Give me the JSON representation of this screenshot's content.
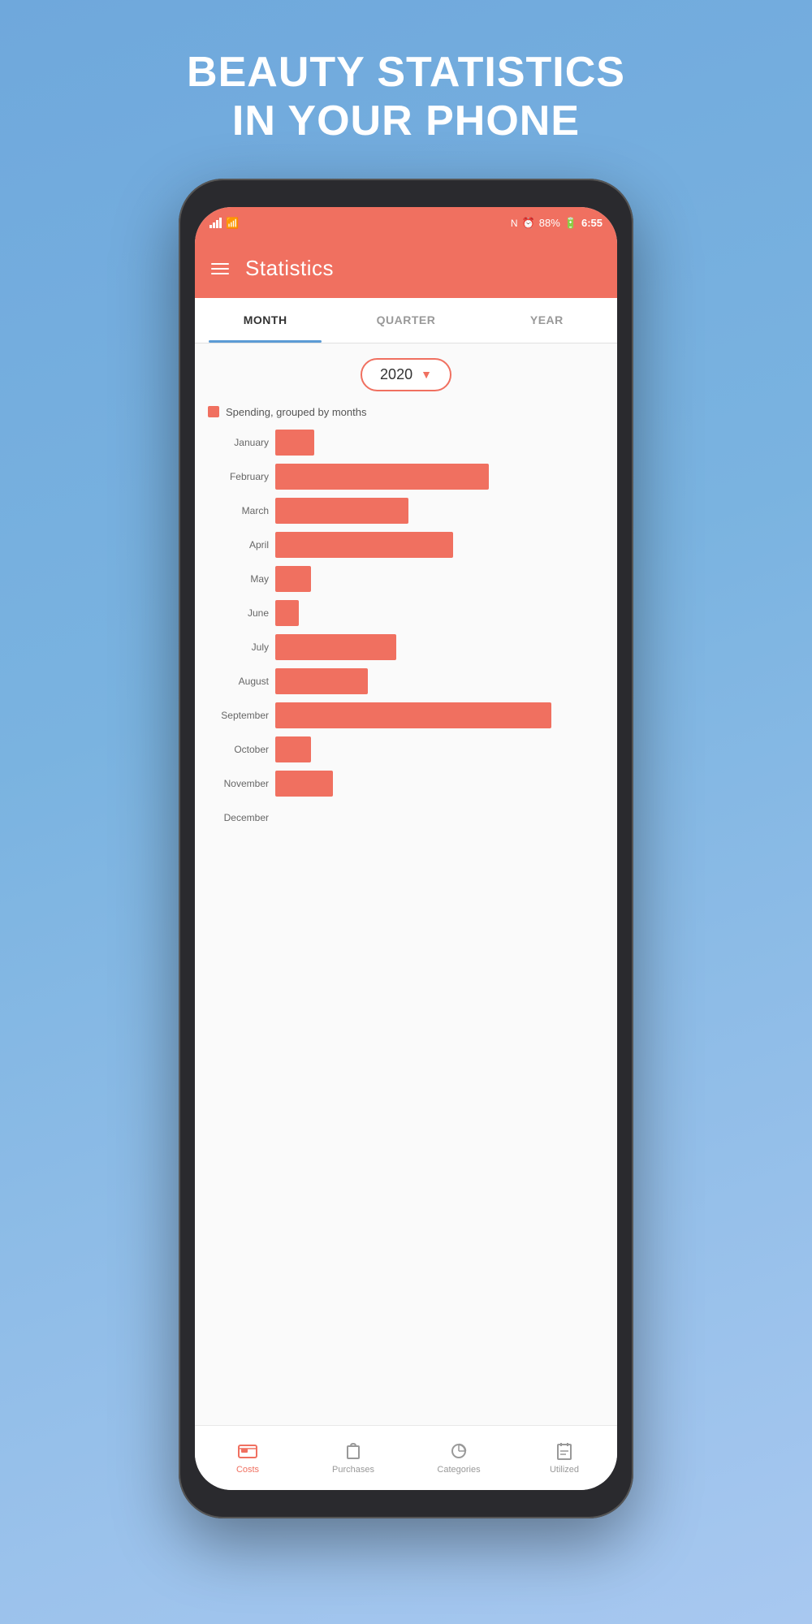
{
  "hero": {
    "line1": "BEAUTY STATISTICS",
    "line2": "IN YOUR PHONE"
  },
  "status_bar": {
    "battery": "88%",
    "time": "6:55"
  },
  "header": {
    "title": "Statistics"
  },
  "tabs": [
    {
      "label": "MONTH",
      "active": true
    },
    {
      "label": "QUARTER",
      "active": false
    },
    {
      "label": "YEAR",
      "active": false
    }
  ],
  "year_selector": {
    "value": "2020"
  },
  "chart": {
    "legend": "Spending, grouped by months",
    "max_value": 389,
    "bars": [
      {
        "month": "January",
        "value": 55
      },
      {
        "month": "February",
        "value": 301
      },
      {
        "month": "March",
        "value": 188
      },
      {
        "month": "April",
        "value": 250
      },
      {
        "month": "May",
        "value": 50
      },
      {
        "month": "June",
        "value": 33
      },
      {
        "month": "July",
        "value": 170
      },
      {
        "month": "August",
        "value": 131
      },
      {
        "month": "September",
        "value": 389
      },
      {
        "month": "October",
        "value": 50
      },
      {
        "month": "November",
        "value": 81
      },
      {
        "month": "December",
        "value": 0
      }
    ]
  },
  "bottom_nav": [
    {
      "label": "Costs",
      "icon": "costs-icon",
      "active": true
    },
    {
      "label": "Purchases",
      "icon": "purchases-icon",
      "active": false
    },
    {
      "label": "Categories",
      "icon": "categories-icon",
      "active": false
    },
    {
      "label": "Utilized",
      "icon": "utilized-icon",
      "active": false
    }
  ]
}
